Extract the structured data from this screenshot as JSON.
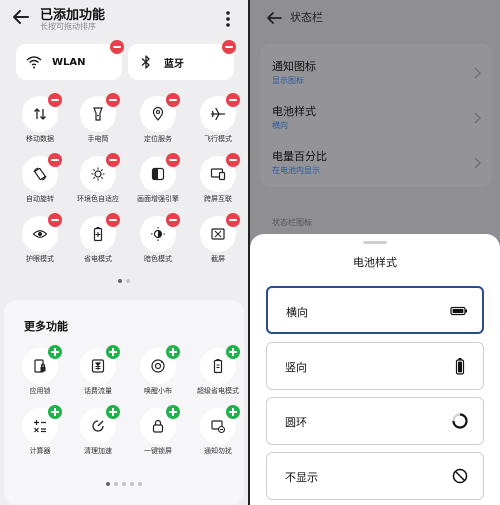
{
  "left": {
    "title": "已添加功能",
    "subtitle": "长按可拖动排序",
    "pills": [
      {
        "label": "WLAN",
        "icon": "wifi-icon"
      },
      {
        "label": "蓝牙",
        "icon": "bluetooth-icon"
      }
    ],
    "added_tiles": [
      {
        "label": "移动数据",
        "icon": "mobile-data-icon"
      },
      {
        "label": "手电筒",
        "icon": "flashlight-icon"
      },
      {
        "label": "定位服务",
        "icon": "location-icon"
      },
      {
        "label": "飞行模式",
        "icon": "airplane-icon"
      },
      {
        "label": "自动旋转",
        "icon": "auto-rotate-icon"
      },
      {
        "label": "环境色自适应",
        "icon": "ambient-color-icon"
      },
      {
        "label": "画面增强引擎",
        "icon": "display-enhance-icon"
      },
      {
        "label": "跨屏互联",
        "icon": "screen-cast-icon"
      },
      {
        "label": "护眼模式",
        "icon": "eye-protection-icon"
      },
      {
        "label": "省电模式",
        "icon": "battery-saver-icon"
      },
      {
        "label": "暗色模式",
        "icon": "dark-mode-icon"
      },
      {
        "label": "截屏",
        "icon": "screenshot-icon"
      }
    ],
    "more_title": "更多功能",
    "more_tiles": [
      {
        "label": "应用锁",
        "icon": "app-lock-icon"
      },
      {
        "label": "话费流量",
        "icon": "data-fee-icon"
      },
      {
        "label": "唤醒小布",
        "icon": "assistant-icon"
      },
      {
        "label": "超级省电模式",
        "icon": "super-saver-icon"
      },
      {
        "label": "计算器",
        "icon": "calculator-icon"
      },
      {
        "label": "清理加速",
        "icon": "cleanup-icon"
      },
      {
        "label": "一键锁屏",
        "icon": "lock-screen-icon"
      },
      {
        "label": "通知勿扰",
        "icon": "do-not-disturb-icon"
      }
    ]
  },
  "right": {
    "title": "状态栏",
    "settings": [
      {
        "title": "通知图标",
        "sub": "显示图标"
      },
      {
        "title": "电池样式",
        "sub": "横向"
      },
      {
        "title": "电量百分比",
        "sub": "在电池内显示"
      }
    ],
    "section_label": "状态栏图标",
    "sheet_title": "电池样式",
    "options": [
      {
        "label": "横向",
        "icon": "battery-horizontal-icon",
        "selected": true
      },
      {
        "label": "竖向",
        "icon": "battery-vertical-icon",
        "selected": false
      },
      {
        "label": "圆环",
        "icon": "battery-ring-icon",
        "selected": false
      },
      {
        "label": "不显示",
        "icon": "hide-icon",
        "selected": false
      }
    ]
  },
  "colors": {
    "remove_badge": "#e8404a",
    "add_badge": "#22b24c",
    "selected_border": "#2a4d8f",
    "link_blue": "#2a5aa0"
  }
}
